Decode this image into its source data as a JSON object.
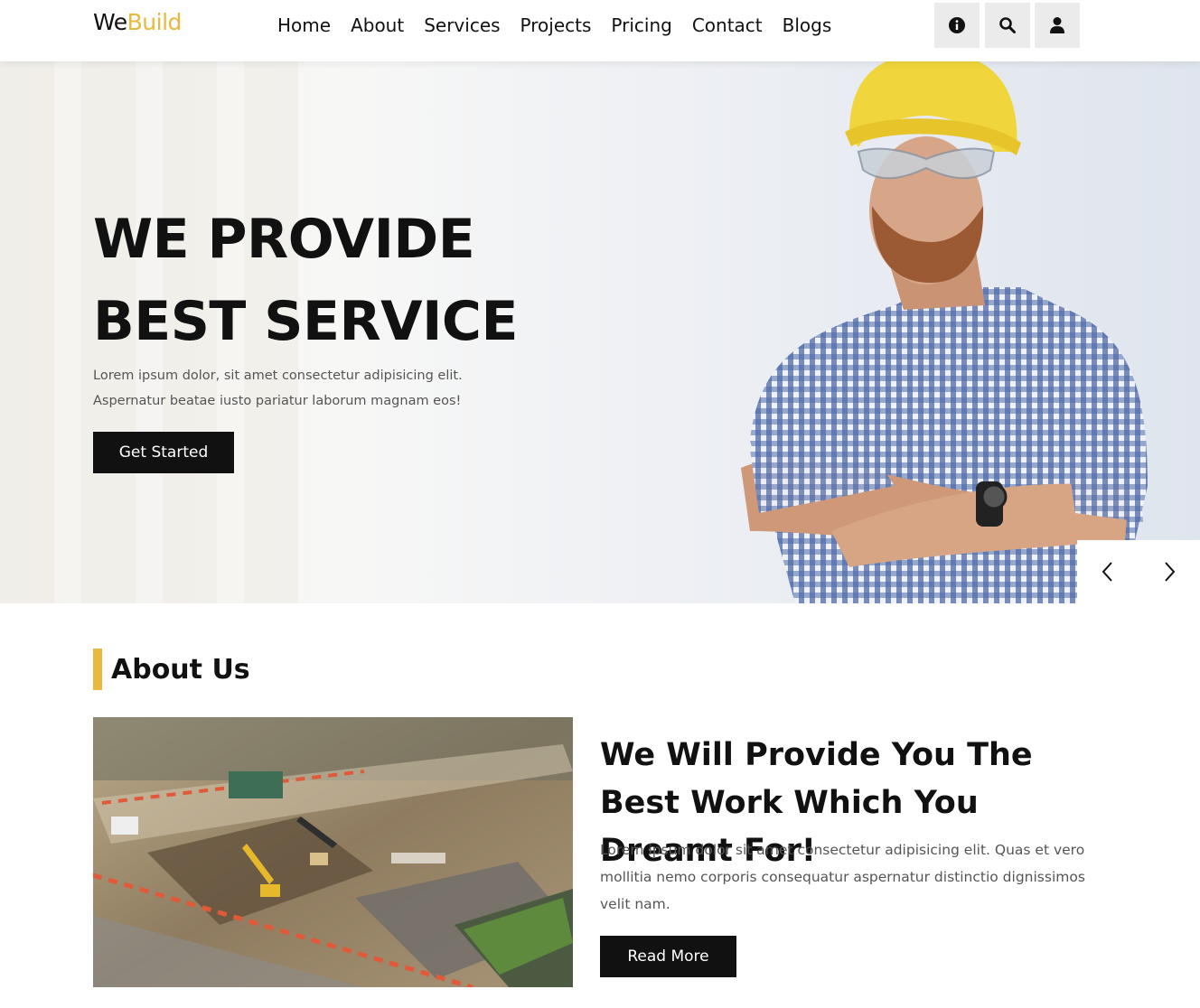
{
  "header": {
    "logo_we": "We",
    "logo_build": "Build",
    "nav": [
      "Home",
      "About",
      "Services",
      "Projects",
      "Pricing",
      "Contact",
      "Blogs"
    ],
    "icons": [
      "info-icon",
      "search-icon",
      "user-icon"
    ]
  },
  "hero": {
    "title_line1": "WE PROVIDE",
    "title_line2": "BEST SERVICE",
    "text": "Lorem ipsum dolor, sit amet consectetur adipisicing elit. Aspernatur beatae iusto pariatur laborum magnam eos!",
    "button": "Get Started",
    "prev_icon": "chevron-left-icon",
    "next_icon": "chevron-right-icon"
  },
  "about": {
    "section_title": "About Us",
    "heading": "We Will Provide You The Best Work Which You Dreamt For!",
    "text": "Lorem ipsum dolor sit amet consectetur adipisicing elit. Quas et vero mollitia nemo corporis consequatur aspernatur distinctio dignissimos velit nam.",
    "button": "Read More"
  },
  "colors": {
    "accent": "#e9b93f",
    "dark": "#111111",
    "icon_bg": "#ebebeb"
  }
}
